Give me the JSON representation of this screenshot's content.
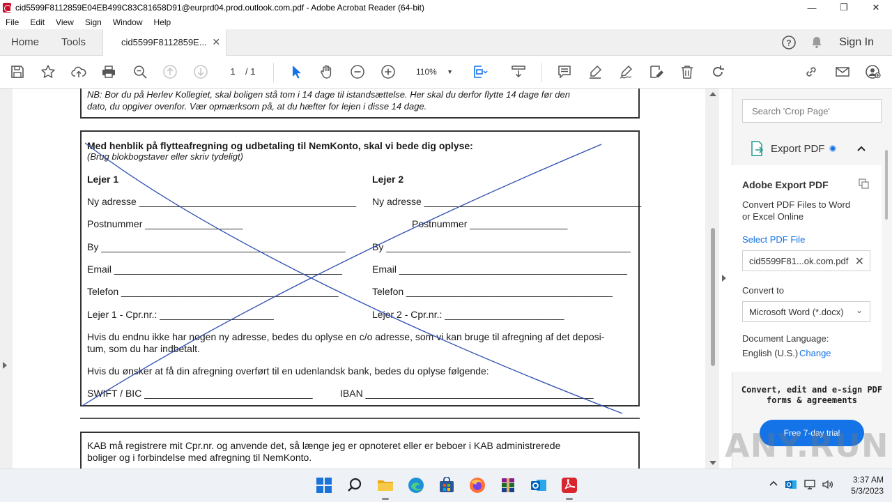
{
  "window": {
    "title": "cid5599F8112859E04EB499C83C81658D91@eurprd04.prod.outlook.com.pdf - Adobe Acrobat Reader (64-bit)",
    "minimize": "—",
    "maximize": "❐",
    "close": "✕"
  },
  "menu": [
    "File",
    "Edit",
    "View",
    "Sign",
    "Window",
    "Help"
  ],
  "tabs": {
    "home": "Home",
    "tools": "Tools",
    "document": "cid5599F8112859E...",
    "close": "✕",
    "sign_in": "Sign In"
  },
  "toolbar": {
    "page_current": "1",
    "page_total": "/ 1",
    "zoom": "110%"
  },
  "document": {
    "note_line1": "NB: Bor du på Herlev Kollegiet, skal boligen stå tom i 14 dage til istandsættelse. Her skal du derfor flytte 14 dage før den",
    "note_line2": "dato, du opgiver ovenfor. Vær opmærksom på, at du hæfter for lejen i disse 14 dage.",
    "heading": "Med henblik på flytteafregning og udbetaling til NemKonto, skal vi bede dig oplyse:",
    "subheading": "(Brug blokbogstaver eller skriv tydeligt)",
    "tenant1": "Lejer 1",
    "tenant2": "Lejer 2",
    "new_address_1": "Ny adresse ________________________________________",
    "new_address_2": "Ny adresse ________________________________________",
    "postcode_1": "Postnummer __________________",
    "postcode_2": "Postnummer __________________",
    "city_1": "By _____________________________________________",
    "city_2": "By _____________________________________________",
    "email_1": "Email __________________________________________",
    "email_2": "Email __________________________________________",
    "phone_1": "Telefon ________________________________________",
    "phone_2": "Telefon ______________________________________",
    "cpr_1": "Lejer 1 - Cpr.nr.:   _____________________",
    "cpr_2": "Lejer 2 - Cpr.nr.:  ______________________",
    "no_address_1": "Hvis du endnu ikke har nogen ny adresse, bedes du oplyse en c/o adresse, som vi kan bruge til afregning af det deposi-",
    "no_address_2": "tum, som du har indbetalt.",
    "foreign_bank": "Hvis du ønsker at få din afregning overført til en udenlandsk bank, bedes du oplyse følgende:",
    "swift": "SWIFT / BIC _______________________________",
    "iban": "IBAN __________________________________________",
    "kab_line1": "KAB må registrere mit Cpr.nr. og anvende det, så længe jeg er opnoteret eller er beboer i KAB administrerede",
    "kab_line2": "boliger og i forbindelse med afregning til NemKonto."
  },
  "right_panel": {
    "search_placeholder": "Search 'Crop Page'",
    "export_pdf": "Export PDF",
    "adobe_export_pdf": "Adobe Export PDF",
    "convert_desc_1": "Convert PDF Files to Word",
    "convert_desc_2": "or Excel Online",
    "select_file": "Select PDF File",
    "file_name": "cid5599F81...ok.com.pdf",
    "convert_to": "Convert to",
    "format": "Microsoft Word (*.docx)",
    "doc_language": "Document Language:",
    "language": "English (U.S.)",
    "change": "Change",
    "promo_1": "Convert, edit and e-sign PDF",
    "promo_2": "forms & agreements",
    "trial": "Free 7-day trial"
  },
  "watermark": "ANY.RUN",
  "taskbar": {
    "time": "3:37 AM",
    "date": "5/3/2023"
  },
  "colors": {
    "accent": "#1473e6",
    "acrobat_red": "#c8102e",
    "scribble_blue": "#2e4fb0"
  }
}
